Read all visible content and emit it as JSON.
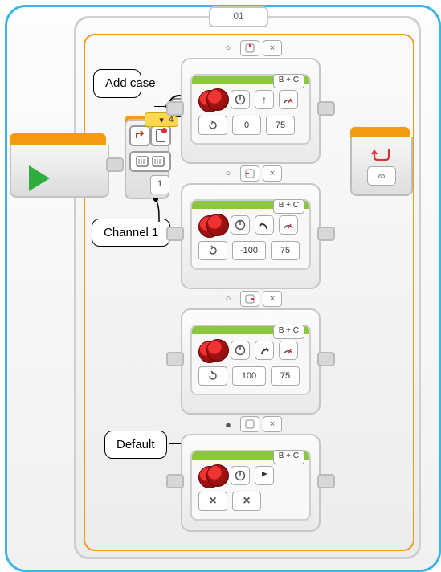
{
  "loop": {
    "label": "01"
  },
  "annotations": {
    "add_case": "Add case",
    "channel": "Channel 1",
    "default": "Default"
  },
  "switch": {
    "cases_count": "4",
    "channel": "1",
    "mode_icon": "ir-beacon-icon",
    "add_case_icon": "plus-icon"
  },
  "loop_end": {
    "mode": "∞",
    "icon": "loop-back-icon"
  },
  "cases": [
    {
      "tab": {
        "value_icon": "dpad-up-icon",
        "delete": "×",
        "default_radio": "○"
      },
      "block": {
        "ports": "B + C",
        "direction_icon": "arrow-up-icon",
        "gauge_icon": "speed-gauge-icon",
        "mode_icon": "rotation-icon",
        "steer": "0",
        "power": "75"
      }
    },
    {
      "tab": {
        "value_icon": "dpad-left-icon",
        "delete": "×",
        "default_radio": "○"
      },
      "block": {
        "ports": "B + C",
        "direction_icon": "curve-left-icon",
        "gauge_icon": "speed-gauge-icon",
        "mode_icon": "rotation-icon",
        "steer": "-100",
        "power": "75"
      }
    },
    {
      "tab": {
        "value_icon": "dpad-right-icon",
        "delete": "×",
        "default_radio": "○"
      },
      "block": {
        "ports": "B + C",
        "direction_icon": "curve-right-icon",
        "gauge_icon": "speed-gauge-icon",
        "mode_icon": "rotation-icon",
        "steer": "100",
        "power": "75"
      }
    },
    {
      "tab": {
        "value_icon": "dpad-none-icon",
        "delete": "×",
        "default_radio": "●"
      },
      "block": {
        "ports": "B + C",
        "direction_icon": "stop-flag-icon",
        "mode_left_icon": "cross-icon",
        "mode_right_icon": "cross-icon"
      }
    }
  ]
}
